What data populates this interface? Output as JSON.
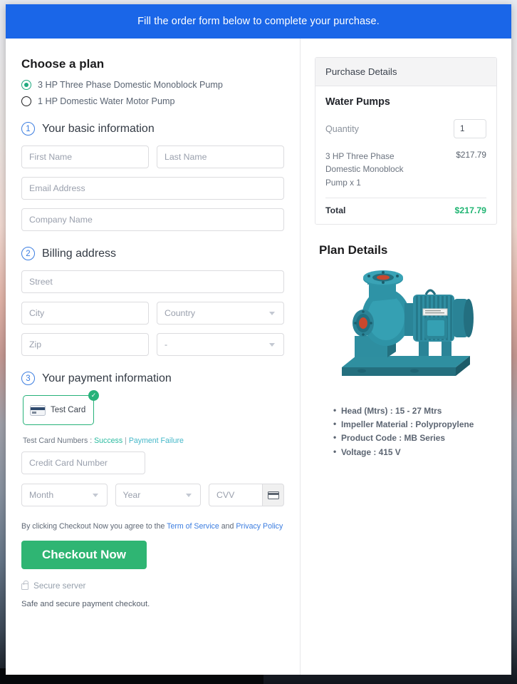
{
  "topbar": {
    "message": "Fill the order form below to complete your purchase."
  },
  "plan": {
    "title": "Choose a plan",
    "options": [
      {
        "label": "3 HP Three Phase Domestic Monoblock Pump",
        "selected": true
      },
      {
        "label": "1 HP Domestic Water Motor Pump",
        "selected": false
      }
    ]
  },
  "steps": {
    "basic": {
      "number": "1",
      "title": "Your basic information"
    },
    "billing": {
      "number": "2",
      "title": "Billing address"
    },
    "payment": {
      "number": "3",
      "title": "Your payment information"
    }
  },
  "basic_fields": {
    "first_name": "First Name",
    "last_name": "Last Name",
    "email": "Email Address",
    "company": "Company Name"
  },
  "billing_fields": {
    "street": "Street",
    "city": "City",
    "country": "Country",
    "zip": "Zip",
    "state": "-"
  },
  "payment": {
    "card_tile_label": "Test Card",
    "card_tile_icon": "credit-card-icon",
    "check_icon": "check-circle-icon",
    "test_numbers_prefix": "Test Card Numbers :",
    "link_success": "Success",
    "link_separator": "|",
    "link_failure": "Payment Failure",
    "credit_card_number": "Credit Card Number",
    "month": "Month",
    "year": "Year",
    "cvv": "CVV",
    "cvv_icon": "credit-card-icon"
  },
  "terms": {
    "prefix": "By clicking Checkout Now you agree to the",
    "tos": "Term of Service",
    "and": "and",
    "privacy": "Privacy Policy"
  },
  "checkout": {
    "button_label": "Checkout Now",
    "lock_icon": "lock-icon",
    "secure_server": "Secure server",
    "safe_note": "Safe and secure payment checkout."
  },
  "purchase_details": {
    "header": "Purchase Details",
    "product_group": "Water Pumps",
    "quantity_label": "Quantity",
    "quantity_value": "1",
    "line_item_name": "3 HP Three Phase Domestic Monoblock Pump x 1",
    "line_item_price": "$217.79",
    "total_label": "Total",
    "total_value": "$217.79"
  },
  "plan_details": {
    "title": "Plan Details",
    "image_alt": "water-pump-image",
    "specs": [
      "Head (Mtrs) : 15 - 27 Mtrs",
      "Impeller Material : Polypropylene",
      "Product Code : MB Series",
      "Voltage : 415 V"
    ]
  },
  "colors": {
    "topbar_blue": "#1a66e8",
    "accent_green": "#2fb573",
    "step_blue": "#3b7de0",
    "total_green": "#21b573",
    "link_teal": "#45b8c9",
    "link_success_green": "#2bbba0"
  }
}
